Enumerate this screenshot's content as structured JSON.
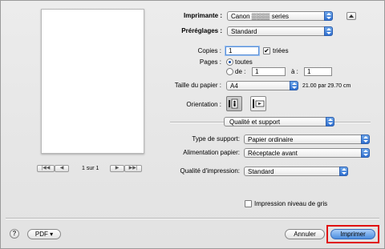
{
  "preview": {
    "page_indicator": "1 sur 1",
    "nav_first": "|◀◀",
    "nav_prev": "◀",
    "nav_next": "▶",
    "nav_last": "▶▶|"
  },
  "printer": {
    "label": "Imprimante :",
    "value": "Canon ▒▒▒▒ series"
  },
  "presets": {
    "label": "Préréglages :",
    "value": "Standard"
  },
  "copies": {
    "label": "Copies :",
    "value": "1",
    "collate_label": "triées",
    "collate_checked": true
  },
  "pages": {
    "label": "Pages :",
    "all_label": "toutes",
    "range_label": "de :",
    "from": "1",
    "to_label": "à :",
    "to": "1",
    "selected": "all"
  },
  "paper_size": {
    "label": "Taille du papier :",
    "value": "A4",
    "dimensions": "21.00 par 29.70 cm"
  },
  "orientation": {
    "label": "Orientation :",
    "selected": "portrait"
  },
  "panel": {
    "value": "Qualité et support"
  },
  "media_type": {
    "label": "Type de support:",
    "value": "Papier ordinaire"
  },
  "paper_source": {
    "label": "Alimentation papier:",
    "value": "Réceptacle avant"
  },
  "print_quality": {
    "label": "Qualité d'impression:",
    "value": "Standard"
  },
  "grayscale": {
    "label": "Impression niveau de gris",
    "checked": false
  },
  "footer": {
    "help_label": "?",
    "pdf_label": "PDF ▾",
    "cancel_label": "Annuler",
    "print_label": "Imprimer"
  },
  "colors": {
    "accent": "#3a7be0",
    "highlight": "#e01010"
  }
}
